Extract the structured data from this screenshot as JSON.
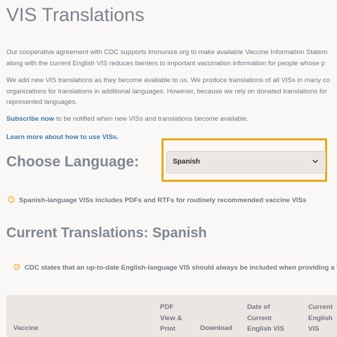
{
  "page": {
    "title": "VIS Translations",
    "paragraphs": [
      "Our cooperative agreement with CDC supports Immunize.org to make available Vaccine Information Statem",
      "along with the current English VIS reduces barriers to important vaccination information for people whose p",
      "We add new VIS translations as they become available to us. We produce translations of all VISs in many co",
      "organizations for translations in additional languages. However, because we rely on donated translations for",
      "represented languages."
    ],
    "subscribe_link": "Subscribe now",
    "subscribe_text": " to be notified when new VISs and translations become available.",
    "learn_link": "Learn more about how to use VISs."
  },
  "language_picker": {
    "label": "Choose Language:",
    "selected": "Spanish"
  },
  "notes": {
    "language_note": "Spanish-language VISs includes PDFs and RTFs for routinely recommended vaccine VISs",
    "cdc_note": "CDC states that an up-to-date English-language VIS should always be included when providing a VIS"
  },
  "translations": {
    "title": "Current Translations: Spanish",
    "headers": {
      "vaccine": "Vaccine",
      "pdf": [
        "PDF",
        "View &",
        "Print"
      ],
      "download": "Download",
      "date": [
        "Date of",
        "Current",
        "English VIS"
      ],
      "current": [
        "Current",
        "English",
        "VIS"
      ]
    }
  },
  "colors": {
    "accent": "#eaa81a",
    "link": "#3e7bb0",
    "background": "#faf8f6"
  }
}
